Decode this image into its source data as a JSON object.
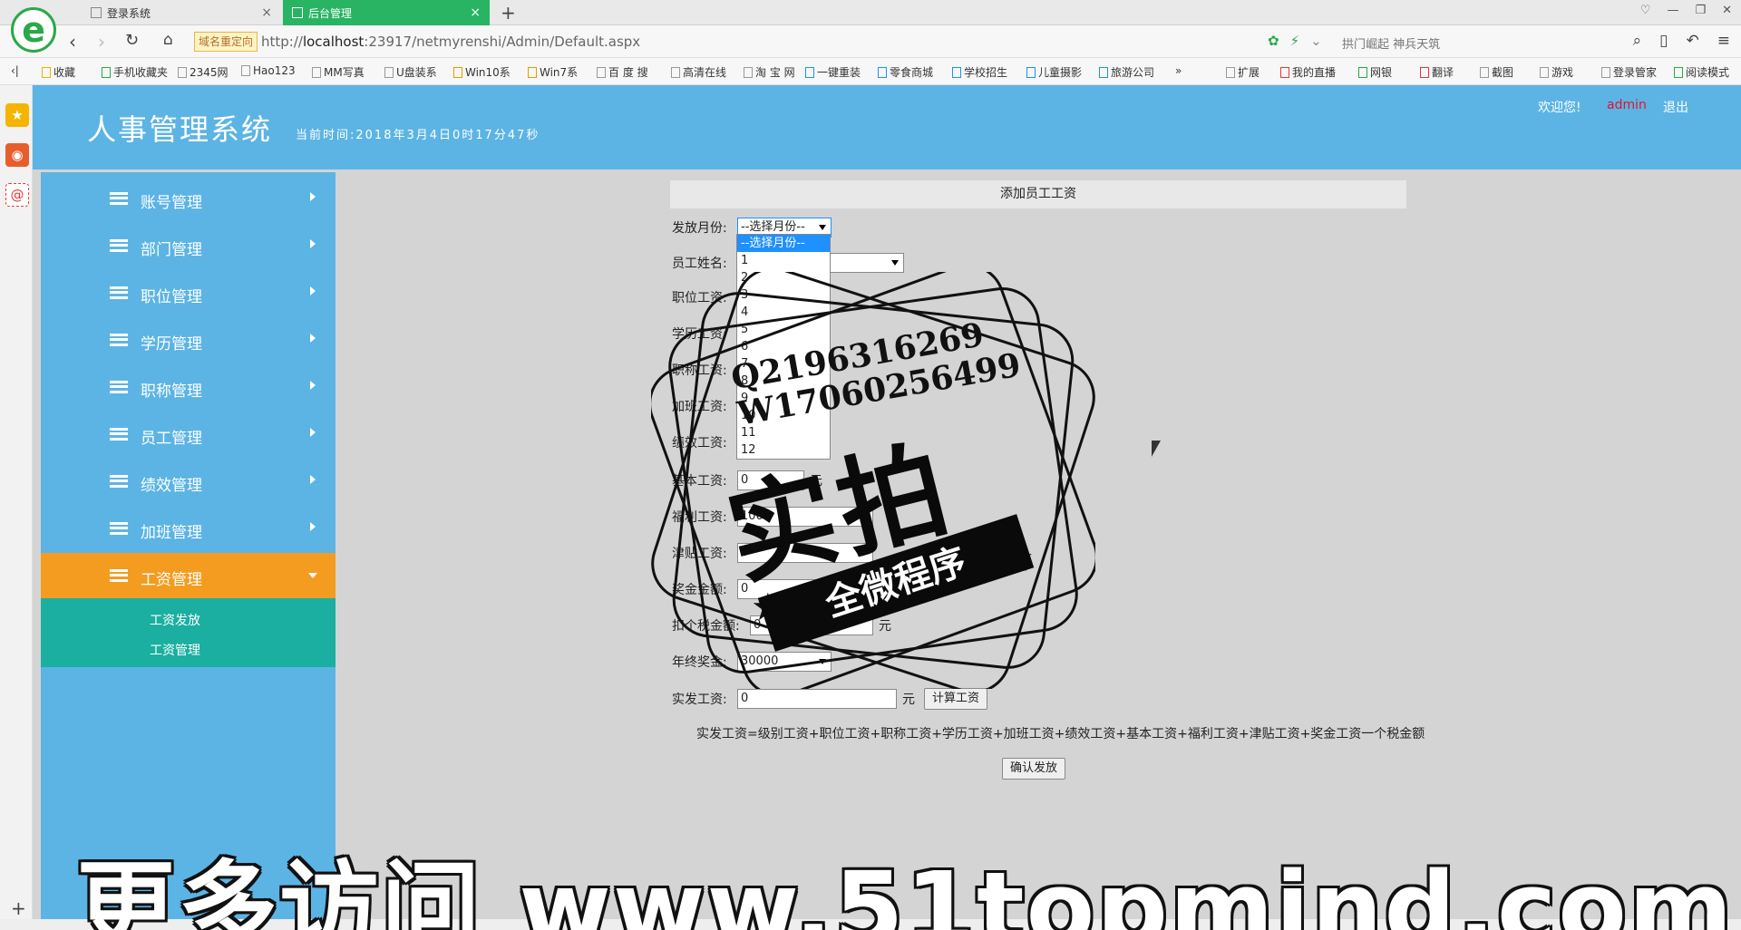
{
  "browser": {
    "tabs": [
      {
        "label": "登录系统"
      },
      {
        "label": "后台管理"
      }
    ],
    "domain_badge": "域名重定向",
    "url_prefix": "http://",
    "url_host": "localhost",
    "url_rest": ":23917/netmyrenshi/Admin/Default.aspx",
    "search_hint": "拱门崛起 神兵天筑",
    "bookmarks": [
      "收藏",
      "手机收藏夹",
      "2345网",
      "Hao123",
      "MM写真",
      "U盘装系",
      "Win10系",
      "Win7系",
      "百 度 搜",
      "高清在线",
      "淘 宝 网",
      "一键重装",
      "零食商城",
      "学校招生",
      "儿童摄影",
      "旅游公司",
      "»",
      "扩展",
      "我的直播",
      "网银",
      "翻译",
      "截图",
      "游戏",
      "登录管家",
      "阅读模式"
    ]
  },
  "app": {
    "title": "人事管理系统",
    "time_label": "当前时间:2018年3月4日0时17分47秒",
    "welcome": "欢迎您!",
    "user": "admin",
    "logout": "退出"
  },
  "menu": {
    "items": [
      {
        "label": "账号管理"
      },
      {
        "label": "部门管理"
      },
      {
        "label": "职位管理"
      },
      {
        "label": "学历管理"
      },
      {
        "label": "职称管理"
      },
      {
        "label": "员工管理"
      },
      {
        "label": "绩效管理"
      },
      {
        "label": "加班管理"
      },
      {
        "label": "工资管理"
      }
    ],
    "sub_items": [
      {
        "label": "工资发放"
      },
      {
        "label": "工资管理"
      }
    ]
  },
  "form": {
    "heading": "添加员工工资",
    "month_label": "发放月份:",
    "month_value": "--选择月份--",
    "employee_label": "员工姓名:",
    "position_salary_label": "职位工资:",
    "education_salary_label": "学历工资:",
    "title_salary_label": "职称工资:",
    "overtime_salary_label": "加班工资:",
    "performance_salary_label": "绩效工资:",
    "base_salary_label": "基本工资:",
    "base_salary_value": "0",
    "base_unit": "元",
    "welfare_salary_label": "福利工资:",
    "welfare_salary_value": "1000",
    "allowance_salary_label": "津贴工资:",
    "allowance_salary_value": "0",
    "bonus_label": "奖金金额:",
    "bonus_value": "0",
    "tax_label": "扣个税金额:",
    "tax_value": "0",
    "tax_unit": "元",
    "year_bonus_label": "年终奖金:",
    "year_bonus_value": "30000",
    "actual_label": "实发工资:",
    "actual_value": "0",
    "actual_unit": "元",
    "calc_button": "计算工资",
    "formula": "实发工资=级别工资+职位工资+职称工资+学历工资+加班工资+绩效工资+基本工资+福利工资+津贴工资+奖金工资一个税金额",
    "confirm_button": "确认发放"
  },
  "month_options": [
    "--选择月份--",
    "1",
    "2",
    "3",
    "4",
    "5",
    "6",
    "7",
    "8",
    "9",
    "10",
    "11",
    "12"
  ],
  "watermark": {
    "qq": "Q2196316269",
    "wx": "W17060256499",
    "big": "实拍",
    "banner": "全微程序",
    "bottom": "更多访问 www.51topmind.com"
  }
}
